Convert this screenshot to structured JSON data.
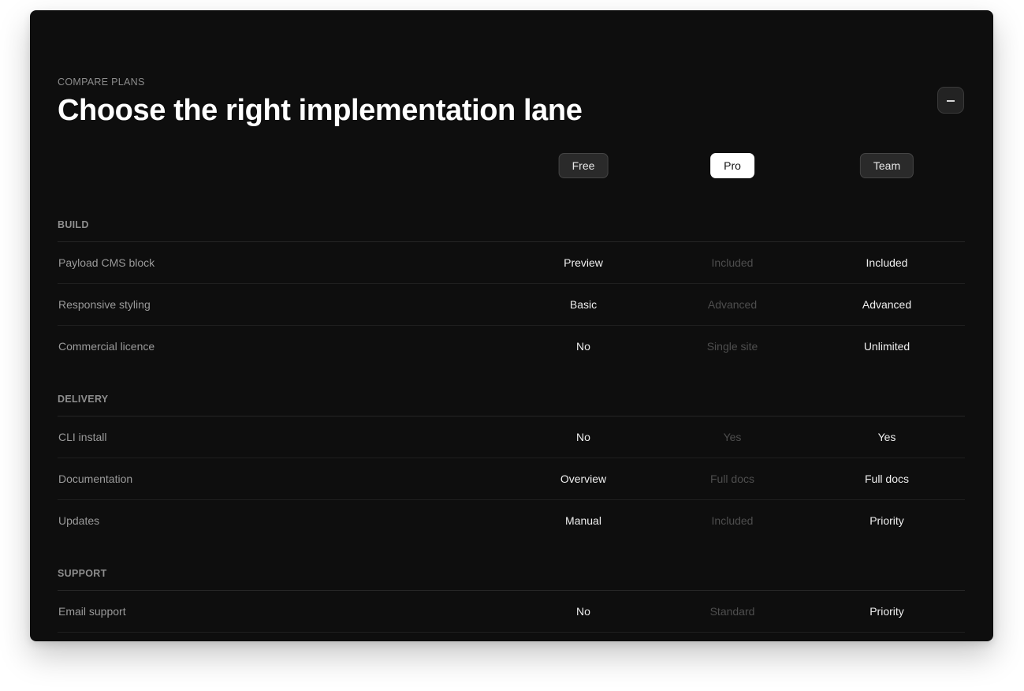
{
  "header": {
    "eyebrow": "COMPARE PLANS",
    "title": "Choose the right implementation lane"
  },
  "plans": [
    {
      "label": "Free",
      "active": false
    },
    {
      "label": "Pro",
      "active": true
    },
    {
      "label": "Team",
      "active": false
    }
  ],
  "sections": [
    {
      "title": "BUILD",
      "rows": [
        {
          "label": "Payload CMS block",
          "free": "Preview",
          "pro": "Included",
          "team": "Included"
        },
        {
          "label": "Responsive styling",
          "free": "Basic",
          "pro": "Advanced",
          "team": "Advanced"
        },
        {
          "label": "Commercial licence",
          "free": "No",
          "pro": "Single site",
          "team": "Unlimited"
        }
      ]
    },
    {
      "title": "DELIVERY",
      "rows": [
        {
          "label": "CLI install",
          "free": "No",
          "pro": "Yes",
          "team": "Yes"
        },
        {
          "label": "Documentation",
          "free": "Overview",
          "pro": "Full docs",
          "team": "Full docs"
        },
        {
          "label": "Updates",
          "free": "Manual",
          "pro": "Included",
          "team": "Priority"
        }
      ]
    },
    {
      "title": "SUPPORT",
      "rows": [
        {
          "label": "Email support",
          "free": "No",
          "pro": "Standard",
          "team": "Priority"
        }
      ]
    }
  ],
  "colors": {
    "panel_bg": "#0e0e0e",
    "active_pill_bg": "#ffffff",
    "muted_cell": "#4e4e4e"
  }
}
